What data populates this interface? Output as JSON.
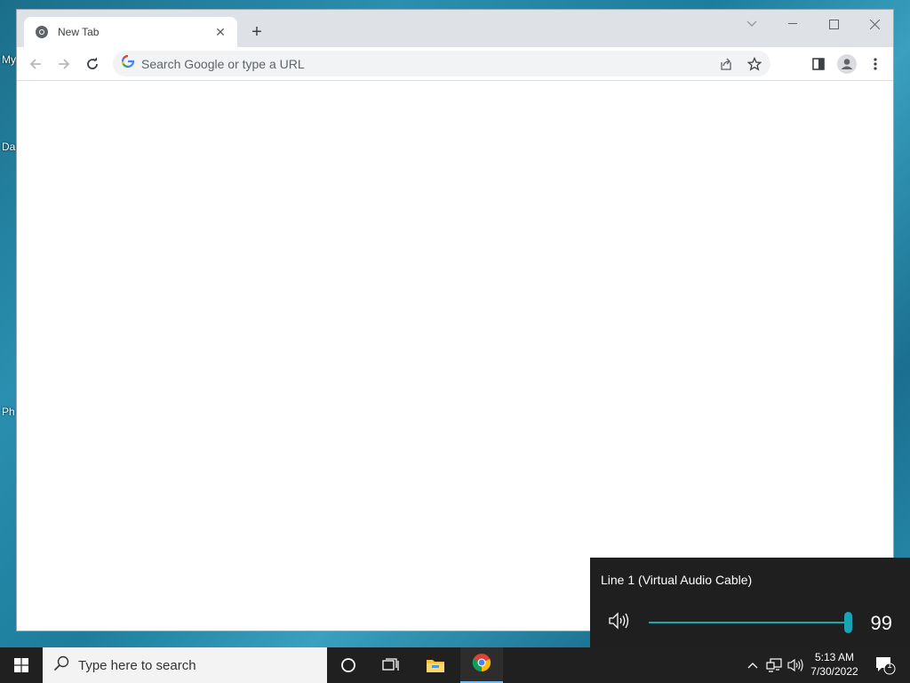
{
  "desktop": {
    "icon_labels": [
      "My",
      "Da",
      "Ph"
    ]
  },
  "browser": {
    "tab_title": "New Tab",
    "omnibox_placeholder": "Search Google or type a URL"
  },
  "volume_flyout": {
    "device_name": "Line 1 (Virtual Audio Cable)",
    "level": 99,
    "accent_color": "#1aa3b5"
  },
  "taskbar": {
    "search_placeholder": "Type here to search",
    "time": "5:13 AM",
    "date": "7/30/2022",
    "notification_count": "1"
  },
  "icons": [
    "chrome-icon",
    "close-icon",
    "plus-icon",
    "chevron-down-icon",
    "minimize-icon",
    "maximize-icon",
    "back-arrow-icon",
    "forward-arrow-icon",
    "reload-icon",
    "google-g-icon",
    "share-icon",
    "star-icon",
    "side-panel-icon",
    "profile-icon",
    "kebab-menu-icon",
    "speaker-icon",
    "windows-logo-icon",
    "search-icon",
    "cortana-icon",
    "task-view-icon",
    "file-explorer-icon",
    "chevron-up-icon",
    "network-icon",
    "notification-icon"
  ]
}
